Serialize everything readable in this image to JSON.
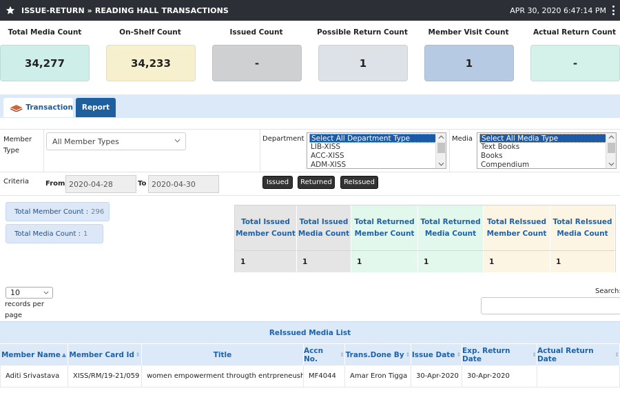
{
  "header": {
    "title": "ISSUE-RETURN » READING HALL TRANSACTIONS",
    "datetime": "APR 30, 2020   6:47:14 PM"
  },
  "stats": [
    {
      "label": "Total Media Count",
      "value": "34,277",
      "color": "#cdeee9"
    },
    {
      "label": "On-Shelf Count",
      "value": "34,233",
      "color": "#f7f0cf"
    },
    {
      "label": "Issued Count",
      "value": "-",
      "color": "#cfd0d2"
    },
    {
      "label": "Possible Return Count",
      "value": "1",
      "color": "#dde2e8"
    },
    {
      "label": "Member Visit Count",
      "value": "1",
      "color": "#b7cae4"
    },
    {
      "label": "Actual Return Count",
      "value": "-",
      "color": "#d4f1ea"
    }
  ],
  "tabs": {
    "transaction": "Transaction",
    "report": "Report"
  },
  "filter": {
    "member_type_label": "Member Type",
    "member_type_value": "All Member Types",
    "department_label": "Department",
    "department_options": [
      "Select All Department Type",
      "LIB-XISS",
      "ACC-XISS",
      "ADM-XISS"
    ],
    "media_label": "Media",
    "media_options": [
      "Select All Media Type",
      "Text Books",
      "Books",
      "Compendium"
    ],
    "criteria_label": "Criteria",
    "from_label": "From",
    "from_value": "2020-04-28",
    "to_label": "To",
    "to_value": "2020-04-30",
    "buttons": {
      "issued": "Issued",
      "returned": "Returned",
      "reissued": "ReIssued"
    }
  },
  "counts": {
    "member_label": "Total Member Count :",
    "member_value": "296",
    "media_label": "Total Media Count :",
    "media_value": "1"
  },
  "summary": [
    {
      "label": "Total Issued Member Count",
      "value": "1",
      "color": "#e5e5e5"
    },
    {
      "label": "Total Issued Media Count",
      "value": "1",
      "color": "#e5e5e5"
    },
    {
      "label": "Total Returned Member Count",
      "value": "1",
      "color": "#e3f8ec"
    },
    {
      "label": "Total Returned Media Count",
      "value": "1",
      "color": "#e3f8ec"
    },
    {
      "label": "Total ReIssued Member Count",
      "value": "1",
      "color": "#fdf5e3"
    },
    {
      "label": "Total ReIssued Media Count",
      "value": "1",
      "color": "#fdf5e3"
    }
  ],
  "table_controls": {
    "records_per_page_value": "10",
    "records_per_page_label": "records per page",
    "search_label": "Search:"
  },
  "reissued_list": {
    "title": "ReIssued Media List",
    "columns": [
      "Member Name",
      "Member Card Id",
      "Title",
      "Accn No.",
      "Trans.Done By",
      "Issue Date",
      "Exp. Return Date",
      "Actual Return Date"
    ],
    "rows": [
      [
        "Aditi Srivastava",
        "XISS/RM/19-21/059",
        "women empowerment througth entrpreneuship",
        "MF4044",
        "Amar Eron Tigga",
        "30-Apr-2020",
        "30-Apr-2020",
        ""
      ]
    ]
  }
}
